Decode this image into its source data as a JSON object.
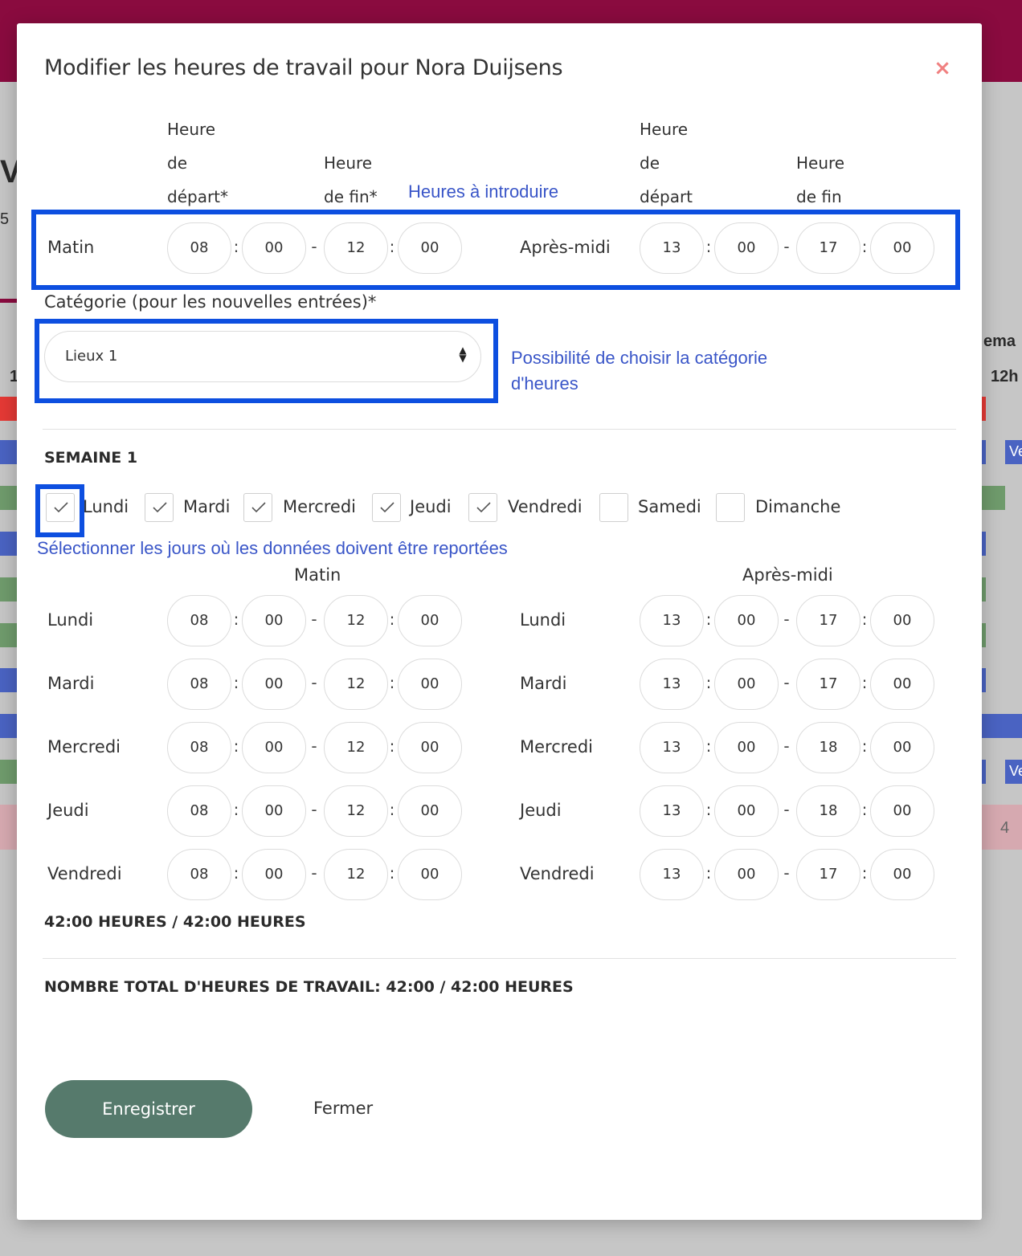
{
  "background": {
    "frag_v": "V",
    "frag_5": "5",
    "frag_1": "1",
    "frag_sema": "ema",
    "frag_12h": "12h",
    "frag_ve1": "Ve",
    "frag_ve2": "Ve",
    "frag_4": "4"
  },
  "modal": {
    "title": "Modifier les heures de travail pour Nora Duijsens",
    "close_glyph": "×",
    "headers": {
      "morning_start": [
        "Heure",
        "de",
        "départ*"
      ],
      "morning_end": [
        "Heure",
        "de fin*"
      ],
      "afternoon_start": [
        "Heure",
        "de",
        "départ"
      ],
      "afternoon_end": [
        "Heure",
        "de fin"
      ]
    },
    "annotations": {
      "hours_to_enter": "Heures à introduire",
      "category_hint_line1": "Possibilité de choisir la catégorie",
      "category_hint_line2": "d'heures",
      "select_days_hint": "Sélectionner les jours où les données doivent être reportées"
    },
    "global_row": {
      "morning_label": "Matin",
      "afternoon_label": "Après-midi",
      "morning": [
        "08",
        "00",
        "12",
        "00"
      ],
      "afternoon": [
        "13",
        "00",
        "17",
        "00"
      ]
    },
    "category": {
      "label": "Catégorie (pour les nouvelles entrées)*",
      "selected": "Lieux 1"
    },
    "week": {
      "title": "SEMAINE 1",
      "days": [
        {
          "label": "Lundi",
          "checked": true
        },
        {
          "label": "Mardi",
          "checked": true
        },
        {
          "label": "Mercredi",
          "checked": true
        },
        {
          "label": "Jeudi",
          "checked": true
        },
        {
          "label": "Vendredi",
          "checked": true
        },
        {
          "label": "Samedi",
          "checked": false
        },
        {
          "label": "Dimanche",
          "checked": false
        }
      ],
      "morning_heading": "Matin",
      "afternoon_heading": "Après-midi",
      "rows": [
        {
          "day": "Lundi",
          "morning": [
            "08",
            "00",
            "12",
            "00"
          ],
          "afternoon": [
            "13",
            "00",
            "17",
            "00"
          ]
        },
        {
          "day": "Mardi",
          "morning": [
            "08",
            "00",
            "12",
            "00"
          ],
          "afternoon": [
            "13",
            "00",
            "17",
            "00"
          ]
        },
        {
          "day": "Mercredi",
          "morning": [
            "08",
            "00",
            "12",
            "00"
          ],
          "afternoon": [
            "13",
            "00",
            "18",
            "00"
          ]
        },
        {
          "day": "Jeudi",
          "morning": [
            "08",
            "00",
            "12",
            "00"
          ],
          "afternoon": [
            "13",
            "00",
            "18",
            "00"
          ]
        },
        {
          "day": "Vendredi",
          "morning": [
            "08",
            "00",
            "12",
            "00"
          ],
          "afternoon": [
            "13",
            "00",
            "17",
            "00"
          ]
        }
      ],
      "week_total": "42:00 HEURES / 42:00 HEURES"
    },
    "grand_total": "NOMBRE TOTAL D'HEURES DE TRAVAIL: 42:00 / 42:00 HEURES",
    "buttons": {
      "save": "Enregistrer",
      "close": "Fermer"
    },
    "separators": {
      "colon": ":",
      "dash": "-"
    }
  }
}
